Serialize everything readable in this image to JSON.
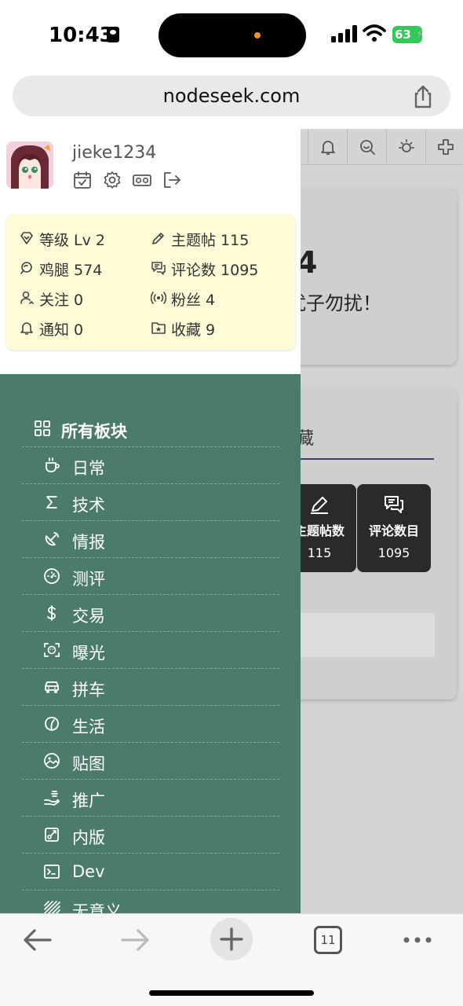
{
  "status_bar": {
    "time": "10:43",
    "battery": "63"
  },
  "browser": {
    "url": "nodeseek.com",
    "tabs_count": "11"
  },
  "user": {
    "username": "jieke1234",
    "actions": [
      "calendar-check-icon",
      "gear-icon",
      "vr-glasses-icon",
      "logout-icon"
    ]
  },
  "stats": {
    "level_label": "等级",
    "level_value": "Lv 2",
    "topics_label": "主题帖",
    "topics_value": "115",
    "chicken_label": "鸡腿",
    "chicken_value": "574",
    "comments_label": "评论数",
    "comments_value": "1095",
    "following_label": "关注",
    "following_value": "0",
    "fans_label": "粉丝",
    "fans_value": "4",
    "notify_label": "通知",
    "notify_value": "0",
    "fav_label": "收藏",
    "fav_value": "9"
  },
  "nav": {
    "header": "所有板块",
    "items": [
      {
        "label": "日常",
        "icon": "coffee-cup-icon"
      },
      {
        "label": "技术",
        "icon": "sigma-icon"
      },
      {
        "label": "情报",
        "icon": "satellite-dish-icon"
      },
      {
        "label": "测评",
        "icon": "gauge-icon"
      },
      {
        "label": "交易",
        "icon": "dollar-icon"
      },
      {
        "label": "曝光",
        "icon": "face-scan-icon"
      },
      {
        "label": "拼车",
        "icon": "car-icon"
      },
      {
        "label": "生活",
        "icon": "leaf-icon"
      },
      {
        "label": "贴图",
        "icon": "image-icon"
      },
      {
        "label": "推广",
        "icon": "hand-coin-icon"
      },
      {
        "label": "内版",
        "icon": "inner-board-icon"
      },
      {
        "label": "Dev",
        "icon": "terminal-icon"
      },
      {
        "label": "无意义",
        "icon": "hatched-square-icon"
      }
    ]
  },
  "background_page": {
    "profile_num_fragment": "4",
    "profile_sub_fragment": "扰子勿扰！",
    "tab_fragment": "藏",
    "stat_topics_label": "主题帖数",
    "stat_topics_value": "115",
    "stat_comments_label": "评论数目",
    "stat_comments_value": "1095"
  },
  "colors": {
    "drawer_nav_bg": "#4a7b6b",
    "stats_panel_bg": "#fefcd7",
    "battery": "#34c759"
  }
}
